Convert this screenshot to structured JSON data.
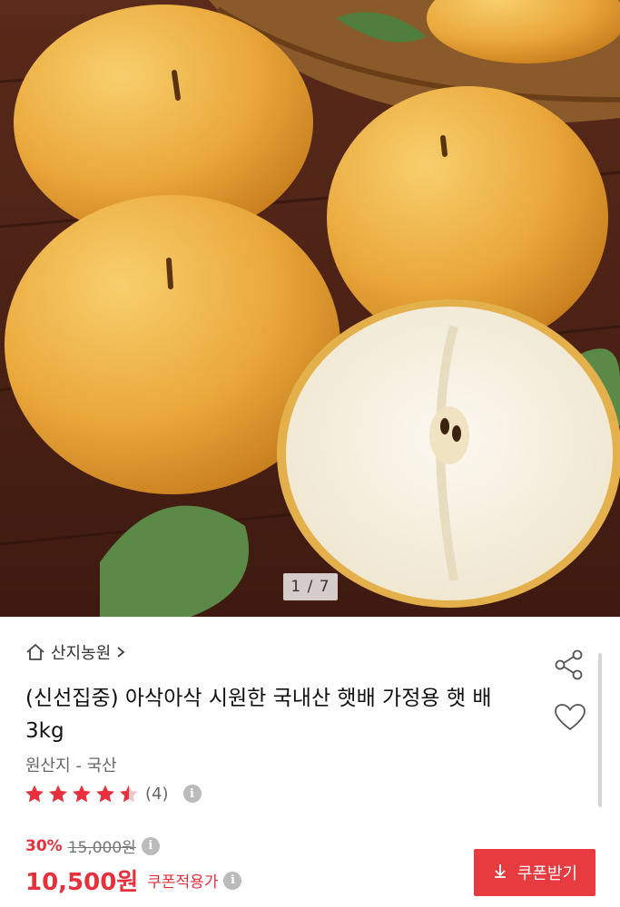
{
  "gallery": {
    "counter": "1 / 7"
  },
  "store": {
    "name": "산지농원"
  },
  "product": {
    "title": "(신선집중) 아삭아삭 시원한 국내산 햇배 가정용 햇 배 3kg",
    "origin": "원산지 - 국산"
  },
  "rating": {
    "stars": 4.5,
    "count": "(4)"
  },
  "price": {
    "discount": "30%",
    "original": "15,000원",
    "sale": "10,500원",
    "coupon_label": "쿠폰적용가"
  },
  "coupon_button": {
    "label": "쿠폰받기"
  },
  "colors": {
    "accent": "#e8303c",
    "star": "#e8303c"
  },
  "icons": [
    "home-icon",
    "chevron-right-icon",
    "share-icon",
    "heart-icon",
    "star-icon",
    "info-icon",
    "download-icon"
  ]
}
